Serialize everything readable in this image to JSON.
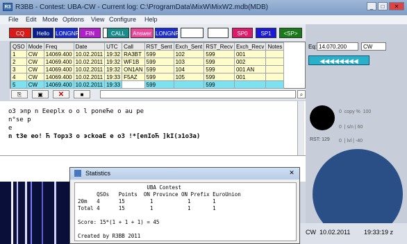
{
  "window": {
    "title": "R3BB - Contest: UBA-CW - Current log: C:\\ProgramData\\MixW\\MixW2.mdb(MDB)",
    "icon_text": "R3BB"
  },
  "menu": [
    "File",
    "Edit",
    "Mode",
    "Options",
    "View",
    "Configure",
    "Help"
  ],
  "macros": [
    {
      "label": "CQ",
      "color": "#d81a1a"
    },
    {
      "label": "Hello",
      "color": "#0a1f8e"
    },
    {
      "label": "LONGNR",
      "color": "#1a2bd8"
    },
    {
      "label": "FIN",
      "color": "#b020c8"
    },
    {
      "label": "",
      "color": "#ffffff"
    },
    {
      "label": "CALL",
      "color": "#1a8c8c"
    },
    {
      "label": "Answer",
      "color": "#e8479a"
    },
    {
      "label": "LONGNR",
      "color": "#1a2bd8"
    },
    {
      "label": "",
      "color": "#ffffff"
    },
    {
      "label": "",
      "color": "#ffffff"
    },
    {
      "label": "SP0",
      "color": "#e01a6a"
    },
    {
      "label": "SP1",
      "color": "#1a1ad8"
    },
    {
      "label": "<SP>",
      "color": "#1a7a1a"
    }
  ],
  "log": {
    "headers": [
      "QSO",
      "Mode",
      "Freq",
      "Date",
      "UTC",
      "Call",
      "RST_Sent",
      "Exch_Sent",
      "RST_Recv",
      "Exch_Recv",
      "Notes"
    ],
    "rows": [
      [
        "1",
        "CW",
        "14069.400",
        "10.02.2011",
        "19:32",
        "RA3BT",
        "599",
        "102",
        "599",
        "001",
        ""
      ],
      [
        "2",
        "CW",
        "14069.400",
        "10.02.2011",
        "19:32",
        "WF1B",
        "599",
        "103",
        "599",
        "002",
        ""
      ],
      [
        "3",
        "CW",
        "14069.400",
        "10.02.2011",
        "19:32",
        "ON1AN",
        "599",
        "104",
        "599",
        "001 AN",
        ""
      ],
      [
        "4",
        "CW",
        "14069.400",
        "10.02.2011",
        "19:33",
        "F5AZ",
        "599",
        "105",
        "599",
        "001",
        ""
      ],
      [
        "5",
        "CW",
        "14069.400",
        "10.02.2011",
        "19:33",
        "",
        "599",
        "",
        "599",
        "",
        ""
      ]
    ]
  },
  "rx_text": [
    "o3 эпр n Eeeplx o o  l poneЋe o au pe",
    "n°se p",
    "e",
    "n t3e eo! Ћ  Topз3  o эckoaE  e   o3  !*[enIoЋ ]kI(з1o3a)"
  ],
  "freq_panel": {
    "label": "Eq:",
    "freq": "14.070.200",
    "mode": "CW"
  },
  "meters": {
    "copy": "0  copy %  100",
    "sn": "0  | s/n | 60",
    "rst_label": "RST: 129",
    "lvl": "0  | lvl | -40"
  },
  "stats": {
    "title": "Statistics",
    "lines": [
      "                      UBA Contest",
      "      QSOs   Points  ON Province ON Prefix EuroUnion",
      "20m   4      15        1           1       1",
      "Total 4      15        1           1       1",
      "",
      "Score: 15*(1 + 1 + 1) = 45",
      "",
      "Created by R3BB 2011"
    ]
  },
  "status": {
    "mode": "CW",
    "date": "10.02.2011",
    "time": "19:33:19 z"
  },
  "colors": {
    "accent": "#7f9cc4",
    "sel_row": "#7de2f0",
    "row": "#fffccc"
  }
}
